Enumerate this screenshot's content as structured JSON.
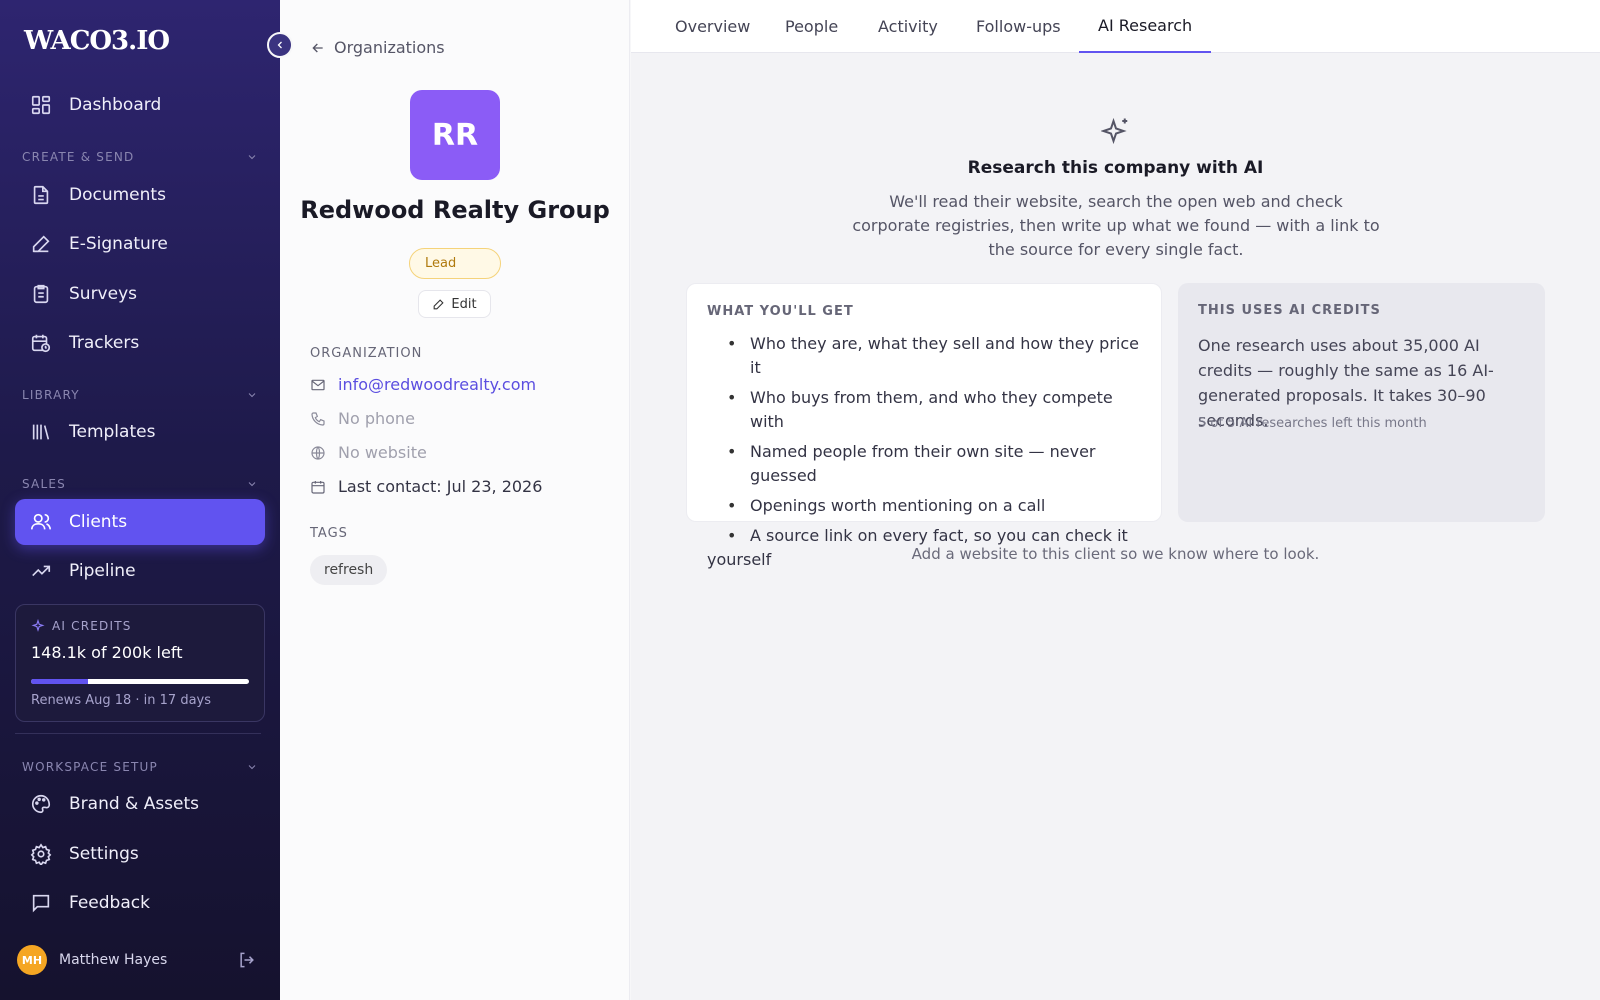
{
  "app": {
    "logo": "WACO3.IO"
  },
  "sidebar": {
    "dashboard": "Dashboard",
    "sections": {
      "create_send": "CREATE & SEND",
      "library": "LIBRARY",
      "sales": "SALES",
      "workspace": "WORKSPACE SETUP"
    },
    "items": {
      "documents": "Documents",
      "esignature": "E-Signature",
      "surveys": "Surveys",
      "trackers": "Trackers",
      "templates": "Templates",
      "clients": "Clients",
      "pipeline": "Pipeline",
      "brand": "Brand & Assets",
      "settings": "Settings",
      "feedback": "Feedback"
    },
    "credits": {
      "label": "AI CREDITS",
      "amount": "148.1k of 200k left",
      "used_fraction": 0.26,
      "renew": "Renews Aug 18 · in 17 days"
    },
    "user": {
      "initials": "MH",
      "name": "Matthew Hayes"
    }
  },
  "org": {
    "back": "Organizations",
    "initials": "RR",
    "name": "Redwood Realty Group",
    "status": "Lead",
    "edit": "Edit",
    "section_label": "ORGANIZATION",
    "email": "info@redwoodrealty.com",
    "phone": "No phone",
    "website": "No website",
    "last_contact": "Last contact: Jul 23, 2026",
    "tags_label": "TAGS",
    "tags": [
      "refresh"
    ]
  },
  "tabs": [
    "Overview",
    "People",
    "Activity",
    "Follow-ups",
    "AI Research"
  ],
  "research": {
    "title": "Research this company with AI",
    "description": "We'll read their website, search the open web and check corporate registries, then write up what we found — with a link to the source for every single fact.",
    "get_heading": "WHAT YOU'LL GET",
    "bullets": [
      "Who they are, what they sell and how they price it",
      "Who buys from them, and who they compete with",
      "Named people from their own site — never guessed",
      "Openings worth mentioning on a call",
      "A source link on every fact, so you can check it",
      "yourself"
    ],
    "credits_heading": "THIS USES AI CREDITS",
    "credits_text": "One research uses about 35,000 AI credits — roughly the same as 16 AI-generated proposals. It takes 30–90 seconds.",
    "credits_left": "5 of 5 AI researches left this month",
    "hint": "Add a website to this client so we know where to look."
  },
  "colors": {
    "accent": "#6153f0",
    "avatar": "#8b5cf6",
    "lead": "#b07a0e"
  }
}
